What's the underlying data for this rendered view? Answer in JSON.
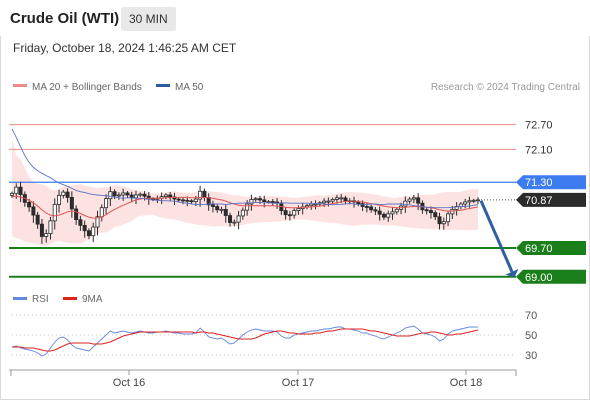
{
  "header": {
    "title": "Crude Oil (WTI)",
    "timeframe": "30 MIN",
    "datetime": "Friday, October 18, 2024 1:46:25 AM CET"
  },
  "legend": {
    "ma20_label": "MA 20 + Bollinger Bands",
    "ma50_label": "MA 50",
    "copyright": "Research © 2024 Trading Central",
    "rsi_label": "RSI",
    "rsi_ma_label": "9MA"
  },
  "colors": {
    "candle": "#2b2b2b",
    "ma20": "#e05555",
    "ma50": "#5a72c8",
    "bollinger_fill": "#fde2e2",
    "resistance_line": "#ef8a8a",
    "pivot_line": "#3d7cf0",
    "support_line": "#1a7f1a",
    "current_price_bg": "#2b2b2b",
    "rsi_line": "#6688e0",
    "rsi_ma_line": "#dd2222",
    "arrow": "#2f5fa0"
  },
  "chart_data": [
    {
      "type": "candlestick",
      "title": "Crude Oil (WTI)",
      "timeframe": "30 MIN",
      "x_tick_labels": [
        "Oct 16",
        "Oct 17",
        "Oct 18"
      ],
      "ylim": [
        68.8,
        73.3
      ],
      "horizontal_levels": [
        {
          "value": 72.7,
          "label": "72.70",
          "kind": "resistance"
        },
        {
          "value": 72.1,
          "label": "72.10",
          "kind": "resistance"
        },
        {
          "value": 71.3,
          "label": "71.30",
          "kind": "pivot"
        },
        {
          "value": 70.87,
          "label": "70.87",
          "kind": "current_price"
        },
        {
          "value": 69.7,
          "label": "69.70",
          "kind": "support"
        },
        {
          "value": 69.0,
          "label": "69.00",
          "kind": "support"
        }
      ],
      "current_price": 70.87,
      "forecast_arrow": {
        "from": 70.85,
        "to": 69.0,
        "direction": "down"
      },
      "closes": [
        71.03,
        71.18,
        71.0,
        70.81,
        70.7,
        70.5,
        70.28,
        69.98,
        70.05,
        70.36,
        70.76,
        70.98,
        71.06,
        70.93,
        70.65,
        70.39,
        70.25,
        70.12,
        70.0,
        70.21,
        70.46,
        70.68,
        70.9,
        71.07,
        70.97,
        70.99,
        71.04,
        70.99,
        70.92,
        70.99,
        71.01,
        70.96,
        70.9,
        70.89,
        70.91,
        70.95,
        70.99,
        70.94,
        70.89,
        70.87,
        70.86,
        70.85,
        70.83,
        70.89,
        71.08,
        70.93,
        70.75,
        70.71,
        70.63,
        70.64,
        70.49,
        70.32,
        70.33,
        70.48,
        70.62,
        70.77,
        70.88,
        70.9,
        70.87,
        70.83,
        70.83,
        70.82,
        70.79,
        70.61,
        70.51,
        70.5,
        70.61,
        70.66,
        70.7,
        70.73,
        70.77,
        70.77,
        70.8,
        70.84,
        70.84,
        70.88,
        70.92,
        70.92,
        70.85,
        70.85,
        70.82,
        70.78,
        70.71,
        70.7,
        70.63,
        70.6,
        70.52,
        70.45,
        70.53,
        70.58,
        70.64,
        70.72,
        70.84,
        70.89,
        70.92,
        70.79,
        70.63,
        70.61,
        70.56,
        70.46,
        70.29,
        70.34,
        70.53,
        70.64,
        70.71,
        70.77,
        70.82,
        70.85,
        70.86,
        70.87
      ],
      "ma20": [
        70.95,
        70.96,
        70.94,
        70.91,
        70.86,
        70.8,
        70.72,
        70.63,
        70.55,
        70.5,
        70.48,
        70.5,
        70.54,
        70.58,
        70.6,
        70.58,
        70.54,
        70.49,
        70.45,
        70.43,
        70.43,
        70.46,
        70.51,
        70.58,
        70.64,
        70.69,
        70.74,
        70.78,
        70.83,
        70.87,
        70.89,
        70.91,
        70.91,
        70.91,
        70.91,
        70.91,
        70.92,
        70.92,
        70.93,
        70.93,
        70.93,
        70.93,
        70.92,
        70.92,
        70.93,
        70.93,
        70.92,
        70.91,
        70.89,
        70.87,
        70.84,
        70.8,
        70.77,
        70.74,
        70.73,
        70.73,
        70.73,
        70.73,
        70.73,
        70.73,
        70.73,
        70.73,
        70.72,
        70.71,
        70.69,
        70.68,
        70.68,
        70.68,
        70.69,
        70.69,
        70.7,
        70.71,
        70.72,
        70.74,
        70.76,
        70.78,
        70.8,
        70.82,
        70.83,
        70.84,
        70.84,
        70.83,
        70.82,
        70.8,
        70.78,
        70.76,
        70.74,
        70.72,
        70.7,
        70.69,
        70.68,
        70.68,
        70.69,
        70.7,
        70.71,
        70.71,
        70.7,
        70.69,
        70.68,
        70.66,
        70.63,
        70.61,
        70.6,
        70.6,
        70.61,
        70.62,
        70.64,
        70.66,
        70.68,
        70.7
      ],
      "bollinger_upper": [
        72.37,
        71.94,
        71.86,
        71.64,
        71.44,
        71.31,
        71.25,
        71.25,
        71.21,
        71.12,
        71.1,
        71.13,
        71.2,
        71.21,
        71.21,
        71.24,
        71.25,
        71.21,
        71.2,
        71.18,
        71.16,
        71.17,
        71.18,
        71.18,
        71.24,
        71.21,
        71.19,
        71.17,
        71.13,
        71.1,
        71.09,
        71.08,
        71.05,
        71.02,
        71.03,
        71.04,
        71.05,
        71.07,
        71.08,
        71.06,
        71.05,
        71.04,
        71.04,
        71.06,
        71.05,
        71.06,
        71.08,
        71.07,
        71.06,
        71.05,
        71.02,
        71.0,
        70.98,
        70.98,
        70.96,
        70.94,
        70.95,
        70.94,
        70.95,
        70.96,
        70.96,
        70.97,
        70.95,
        70.95,
        70.95,
        70.93,
        70.92,
        70.93,
        70.94,
        70.95,
        70.96,
        70.98,
        70.98,
        70.97,
        70.99,
        71.0,
        71.03,
        71.04,
        71.05,
        71.07,
        71.06,
        71.05,
        71.04,
        71.03,
        71.02,
        71.0,
        70.98,
        70.96,
        70.94,
        70.92,
        70.92,
        70.95,
        70.95,
        70.97,
        70.96,
        70.97,
        70.99,
        71.0,
        71.0,
        71.01,
        71.04,
        71.06,
        71.07,
        71.06,
        71.06,
        71.07,
        71.1,
        71.12,
        71.13,
        71.14
      ],
      "bollinger_lower": [
        69.99,
        69.94,
        69.91,
        69.85,
        69.83,
        69.81,
        69.79,
        69.75,
        69.76,
        69.8,
        69.85,
        69.87,
        69.85,
        69.82,
        69.82,
        69.81,
        69.8,
        69.86,
        69.91,
        70.01,
        70.05,
        70.07,
        70.08,
        70.13,
        70.21,
        70.23,
        70.27,
        70.31,
        70.36,
        70.44,
        70.48,
        70.49,
        70.51,
        70.51,
        70.47,
        70.44,
        70.42,
        70.4,
        70.39,
        70.37,
        70.34,
        70.31,
        70.3,
        70.27,
        70.26,
        70.25,
        70.24,
        70.22,
        70.23,
        70.23,
        70.23,
        70.22,
        70.23,
        70.24,
        70.26,
        70.29,
        70.3,
        70.31,
        70.32,
        70.33,
        70.33,
        70.34,
        70.34,
        70.35,
        70.36,
        70.38,
        70.39,
        70.39,
        70.39,
        70.39,
        70.37,
        70.36,
        70.34,
        70.33,
        70.31,
        70.31,
        70.3,
        70.28,
        70.27,
        70.25,
        70.24,
        70.25,
        70.27,
        70.27,
        70.27,
        70.27,
        70.26,
        70.25,
        70.25,
        70.25,
        70.24,
        70.22,
        70.21,
        70.2,
        70.19,
        70.18,
        70.17,
        70.17,
        70.16,
        70.15,
        70.15,
        70.15,
        70.14,
        70.14,
        70.14,
        70.13,
        70.13,
        70.13,
        70.14,
        70.14
      ],
      "ma50": [
        72.6,
        72.39,
        72.16,
        71.95,
        71.78,
        71.66,
        71.58,
        71.52,
        71.46,
        71.41,
        71.34,
        71.28,
        71.24,
        71.2,
        71.15,
        71.1,
        71.07,
        71.05,
        71.02,
        71.0,
        70.99,
        70.98,
        70.97,
        70.96,
        70.94,
        70.92,
        70.91,
        70.92,
        70.92,
        70.91,
        70.91,
        70.9,
        70.88,
        70.87,
        70.86,
        70.85,
        70.85,
        70.84,
        70.84,
        70.82,
        70.8,
        70.79,
        70.77,
        70.76,
        70.76,
        70.76,
        70.77,
        70.77,
        70.77,
        70.77,
        70.76,
        70.77,
        70.78,
        70.79,
        70.79,
        70.8,
        70.8,
        70.81,
        70.81,
        70.8,
        70.8,
        70.79,
        70.79,
        70.79,
        70.8,
        70.79,
        70.79,
        70.79,
        70.79,
        70.79,
        70.78,
        70.78,
        70.78,
        70.77,
        70.76,
        70.75,
        70.76,
        70.76,
        70.77,
        70.78,
        70.77,
        70.76,
        70.75,
        70.76,
        70.77,
        70.77,
        70.76,
        70.76,
        70.77,
        70.77,
        70.77,
        70.77,
        70.76,
        70.75,
        70.73,
        70.72,
        70.71,
        70.69,
        70.69,
        70.68,
        70.68,
        70.68,
        70.68,
        70.69,
        70.7,
        70.71,
        70.71,
        70.72,
        70.74,
        70.75
      ]
    },
    {
      "type": "line",
      "title": "RSI",
      "series": [
        {
          "name": "RSI"
        },
        {
          "name": "9MA"
        }
      ],
      "y_tick_labels": [
        "70",
        "50",
        "30"
      ],
      "ylim": [
        15,
        75
      ],
      "reference_lines": [
        70,
        50,
        30
      ],
      "rsi": [
        38,
        39,
        37,
        36,
        35,
        34,
        32,
        29,
        31,
        37,
        43,
        47,
        48,
        45,
        40,
        37,
        36,
        35,
        34,
        38,
        42,
        46,
        50,
        54,
        52,
        53,
        54,
        53,
        52,
        53,
        54,
        53,
        52,
        52,
        53,
        53,
        54,
        53,
        52,
        52,
        51,
        51,
        51,
        52,
        57,
        53,
        48,
        47,
        46,
        47,
        44,
        41,
        42,
        46,
        50,
        53,
        55,
        56,
        55,
        54,
        54,
        54,
        53,
        49,
        47,
        47,
        50,
        51,
        52,
        53,
        54,
        54,
        55,
        56,
        56,
        57,
        58,
        58,
        56,
        56,
        55,
        54,
        52,
        52,
        50,
        49,
        47,
        46,
        48,
        50,
        52,
        54,
        57,
        58,
        59,
        56,
        52,
        51,
        50,
        48,
        44,
        46,
        51,
        54,
        55,
        56,
        57,
        58,
        58,
        58
      ],
      "rsi_9ma": [
        38,
        38,
        38,
        37,
        37,
        37,
        36,
        35,
        34,
        34,
        35,
        37,
        39,
        41,
        42,
        42,
        42,
        42,
        42,
        41,
        41,
        41,
        42,
        43,
        45,
        47,
        49,
        50,
        51,
        52,
        53,
        53,
        53,
        53,
        53,
        53,
        53,
        53,
        53,
        53,
        53,
        53,
        53,
        52,
        53,
        53,
        52,
        52,
        51,
        50,
        49,
        48,
        47,
        46,
        46,
        46,
        46,
        47,
        49,
        51,
        52,
        53,
        54,
        54,
        53,
        52,
        52,
        51,
        51,
        51,
        51,
        52,
        52,
        53,
        54,
        54,
        55,
        56,
        56,
        56,
        56,
        56,
        56,
        55,
        54,
        54,
        53,
        52,
        51,
        50,
        49,
        49,
        49,
        49,
        50,
        51,
        52,
        52,
        53,
        53,
        52,
        51,
        50,
        50,
        51,
        51,
        52,
        53,
        54,
        55
      ]
    }
  ]
}
